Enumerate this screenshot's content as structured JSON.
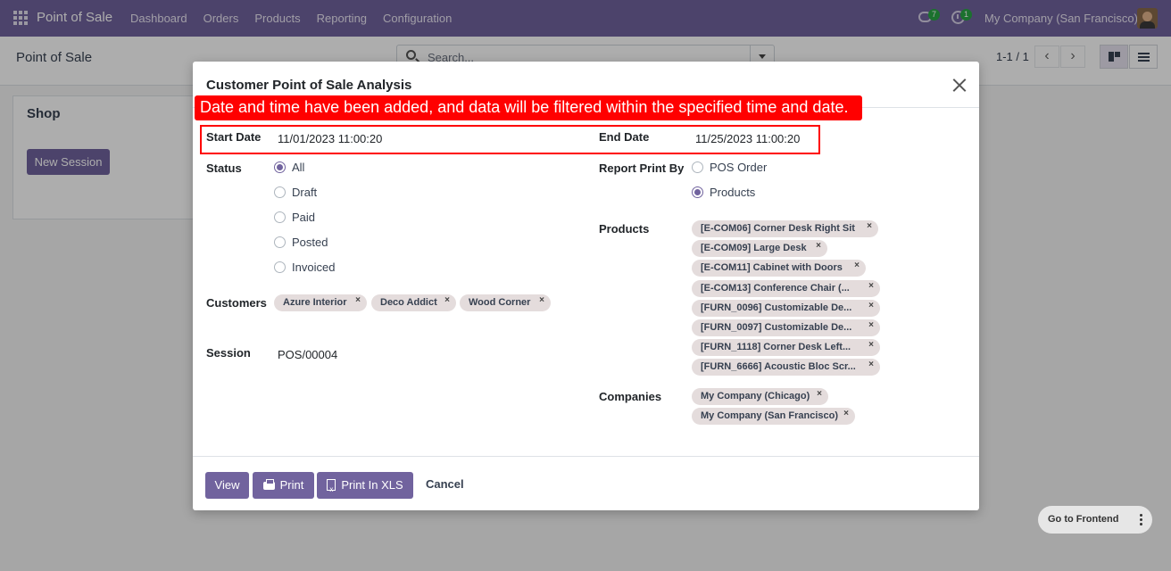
{
  "navbar": {
    "app_title": "Point of Sale",
    "menu": [
      "Dashboard",
      "Orders",
      "Products",
      "Reporting",
      "Configuration"
    ],
    "chat_badge": "7",
    "activity_badge": "1",
    "company": "My Company (San Francisco)"
  },
  "control_panel": {
    "breadcrumb": "Point of Sale",
    "search_placeholder": "Search...",
    "pager": "1-1 / 1"
  },
  "background": {
    "shop_title": "Shop",
    "new_session_label": "New Session",
    "frontend_label": "Go to Frontend"
  },
  "annotation": {
    "text": "Date and time have been added, and data will be filtered within the specified time and date."
  },
  "modal": {
    "title": "Customer Point of Sale Analysis",
    "start_date_label": "Start Date",
    "start_date_value": "11/01/2023 11:00:20",
    "end_date_label": "End Date",
    "end_date_value": "11/25/2023 11:00:20",
    "status_label": "Status",
    "status_options": [
      "All",
      "Draft",
      "Paid",
      "Posted",
      "Invoiced"
    ],
    "status_selected": "All",
    "report_print_by_label": "Report Print By",
    "report_options": [
      "POS Order",
      "Products"
    ],
    "report_selected": "Products",
    "customers_label": "Customers",
    "customers": [
      "Azure Interior",
      "Deco Addict",
      "Wood Corner"
    ],
    "products_label": "Products",
    "products": [
      "[E-COM06] Corner Desk Right Sit",
      "[E-COM09] Large Desk",
      "[E-COM11] Cabinet with Doors",
      "[E-COM13] Conference Chair (...",
      "[FURN_0096] Customizable De...",
      "[FURN_0097] Customizable De...",
      "[FURN_1118] Corner Desk Left...",
      "[FURN_6666] Acoustic Bloc Scr..."
    ],
    "session_label": "Session",
    "session_value": "POS/00004",
    "companies_label": "Companies",
    "companies": [
      "My Company (Chicago)",
      "My Company (San Francisco)"
    ],
    "buttons": {
      "view": "View",
      "print": "Print",
      "print_xls": "Print In XLS",
      "cancel": "Cancel"
    }
  },
  "colors": {
    "brand": "#71639e",
    "annotation": "#ff0000",
    "tag_bg": "#e4dcdc"
  }
}
